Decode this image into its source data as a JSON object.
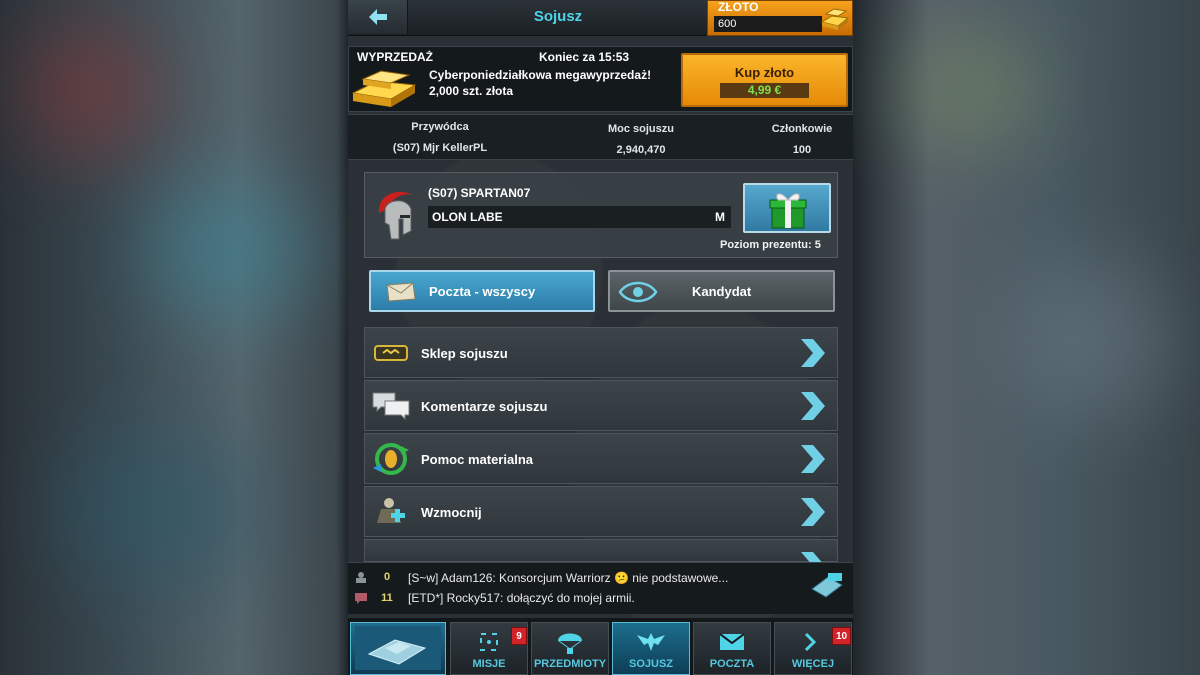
{
  "header": {
    "title": "Sojusz",
    "back_icon": "back-arrow-icon",
    "gold_label": "ZŁOTO",
    "gold_value": "600"
  },
  "sale": {
    "label": "WYPRZEDAŻ",
    "timer": "Koniec za 15:53",
    "line1": "Cyberponiedziałkowa megawyprzedaż!",
    "line2": "2,000 szt. złota",
    "buy_label": "Kup złoto",
    "buy_price": "4,99 €"
  },
  "stats": {
    "headers": [
      "Przywódca",
      "Moc sojuszu",
      "Członkowie"
    ],
    "values": [
      "(S07) Mjr KellerPL",
      "2,940,470",
      "100"
    ]
  },
  "alliance": {
    "name": "(S07) SPARTAN07",
    "motto": "OLON LABE",
    "motto_tag": "M",
    "gift_level": "Poziom prezentu: 5"
  },
  "actions": {
    "mail_all": "Poczta - wszyscy",
    "candidate": "Kandydat"
  },
  "menu": [
    {
      "label": "Sklep sojuszu",
      "icon": "shop-badge-icon"
    },
    {
      "label": "Komentarze sojuszu",
      "icon": "comments-icon"
    },
    {
      "label": "Pomoc materialna",
      "icon": "resource-help-icon"
    },
    {
      "label": "Wzmocnij",
      "icon": "reinforce-soldier-icon"
    }
  ],
  "chat": {
    "messages": [
      {
        "count": "0",
        "text": "[S~w] Adam126: Konsorcjum Warriorz  😕 nie podstawowe..."
      },
      {
        "count": "11",
        "text": "[ETD*] Rocky517: dołączyć do mojej armii."
      }
    ]
  },
  "nav": {
    "items": [
      {
        "label": "",
        "icon": "base-map-icon"
      },
      {
        "label": "MISJE",
        "icon": "crosshair-icon",
        "badge": "9"
      },
      {
        "label": "PRZEDMIOTY",
        "icon": "parachute-icon"
      },
      {
        "label": "SOJUSZ",
        "icon": "eagle-icon"
      },
      {
        "label": "POCZTA",
        "icon": "mail-icon"
      },
      {
        "label": "WIĘCEJ",
        "icon": "chevron-right-icon",
        "badge": "10"
      }
    ]
  },
  "colors": {
    "accent": "#4fd3e6",
    "gold": "#f7a21c",
    "price_green": "#7ee04f",
    "badge_red": "#d3222a"
  }
}
